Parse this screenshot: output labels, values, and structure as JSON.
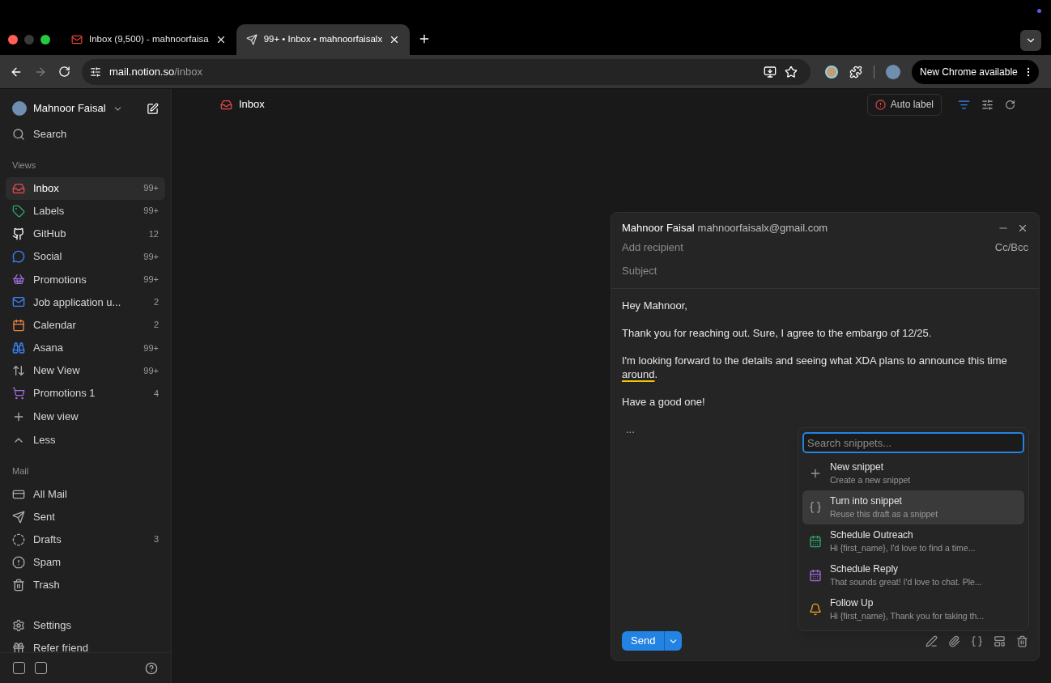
{
  "browser": {
    "tabs": [
      {
        "title": "Inbox (9,500) - mahnoorfaisa",
        "kind": "gmail",
        "selected": false
      },
      {
        "title": "99+ • Inbox • mahnoorfaisalx",
        "kind": "notion-mail",
        "selected": true
      }
    ],
    "address": {
      "host": "mail.notion.so",
      "path": "/inbox"
    },
    "update_button": "New Chrome available"
  },
  "sidebar": {
    "account": "Mahnoor Faisal",
    "search": "Search",
    "views_heading": "Views",
    "views": [
      {
        "label": "Inbox",
        "count": "99+",
        "kind": "inbox",
        "selected": true
      },
      {
        "label": "Labels",
        "count": "99+",
        "kind": "tag",
        "selected": false
      },
      {
        "label": "GitHub",
        "count": "12",
        "kind": "github",
        "selected": false
      },
      {
        "label": "Social",
        "count": "99+",
        "kind": "chat",
        "selected": false
      },
      {
        "label": "Promotions",
        "count": "99+",
        "kind": "basket",
        "selected": false
      },
      {
        "label": "Job application u...",
        "count": "2",
        "kind": "mail",
        "selected": false
      },
      {
        "label": "Calendar",
        "count": "2",
        "kind": "calendar",
        "selected": false
      },
      {
        "label": "Asana",
        "count": "99+",
        "kind": "binoculars",
        "selected": false
      },
      {
        "label": "New View",
        "count": "99+",
        "kind": "sort",
        "selected": false
      },
      {
        "label": "Promotions 1",
        "count": "4",
        "kind": "cart",
        "selected": false
      }
    ],
    "view_actions": [
      {
        "label": "New view",
        "kind": "plus"
      },
      {
        "label": "Less",
        "kind": "chevron-up"
      }
    ],
    "mail_heading": "Mail",
    "mail": [
      {
        "label": "All Mail",
        "kind": "allmail",
        "selected": false
      },
      {
        "label": "Sent",
        "kind": "sent",
        "selected": false
      },
      {
        "label": "Drafts",
        "count": "3",
        "kind": "drafts",
        "selected": false
      },
      {
        "label": "Spam",
        "kind": "spam",
        "selected": false
      },
      {
        "label": "Trash",
        "kind": "trash",
        "selected": false
      }
    ],
    "footer": [
      {
        "label": "Settings",
        "kind": "settings"
      },
      {
        "label": "Refer friend",
        "kind": "gift"
      }
    ]
  },
  "header": {
    "title": "Inbox",
    "auto_label": "Auto label"
  },
  "compose": {
    "from_name": "Mahnoor Faisal",
    "from_email": "mahnoorfaisalx@gmail.com",
    "recipient": {
      "placeholder": "Add recipient"
    },
    "cc_bcc": "Cc/Bcc",
    "subject": {
      "placeholder": "Subject"
    },
    "body": [
      [
        {
          "text": "Hey Mahnoor,",
          "flagged": false
        }
      ],
      [
        {
          "text": "Thank you for reaching out. Sure, I agree to the embargo of 12/25.",
          "flagged": false
        }
      ],
      [
        {
          "text": "I'm looking forward to the details and seeing what XDA plans to announce this time ",
          "flagged": false
        },
        {
          "text": "around",
          "flagged": true
        },
        {
          "text": ".",
          "flagged": false
        }
      ],
      [
        {
          "text": "Have a good one!",
          "flagged": false
        }
      ]
    ],
    "ellipsis": "...",
    "send": "Send"
  },
  "snippets": {
    "search": {
      "placeholder": "Search snippets..."
    },
    "items": [
      {
        "title": "New snippet",
        "subtitle": "Create a new snippet",
        "kind": "plus",
        "selected": false
      },
      {
        "title": "Turn into snippet",
        "subtitle": "Reuse this draft as a snippet",
        "kind": "braces",
        "selected": true
      },
      {
        "title": "Schedule Outreach",
        "subtitle": "Hi {first_name}, I'd love to find a time...",
        "kind": "calendar-green",
        "selected": false
      },
      {
        "title": "Schedule Reply",
        "subtitle": "That sounds great! I'd love to chat. Ple...",
        "kind": "calendar-purple",
        "selected": false
      },
      {
        "title": "Follow Up",
        "subtitle": "Hi {first_name}, Thank you for taking th...",
        "kind": "bell",
        "selected": false
      }
    ]
  }
}
